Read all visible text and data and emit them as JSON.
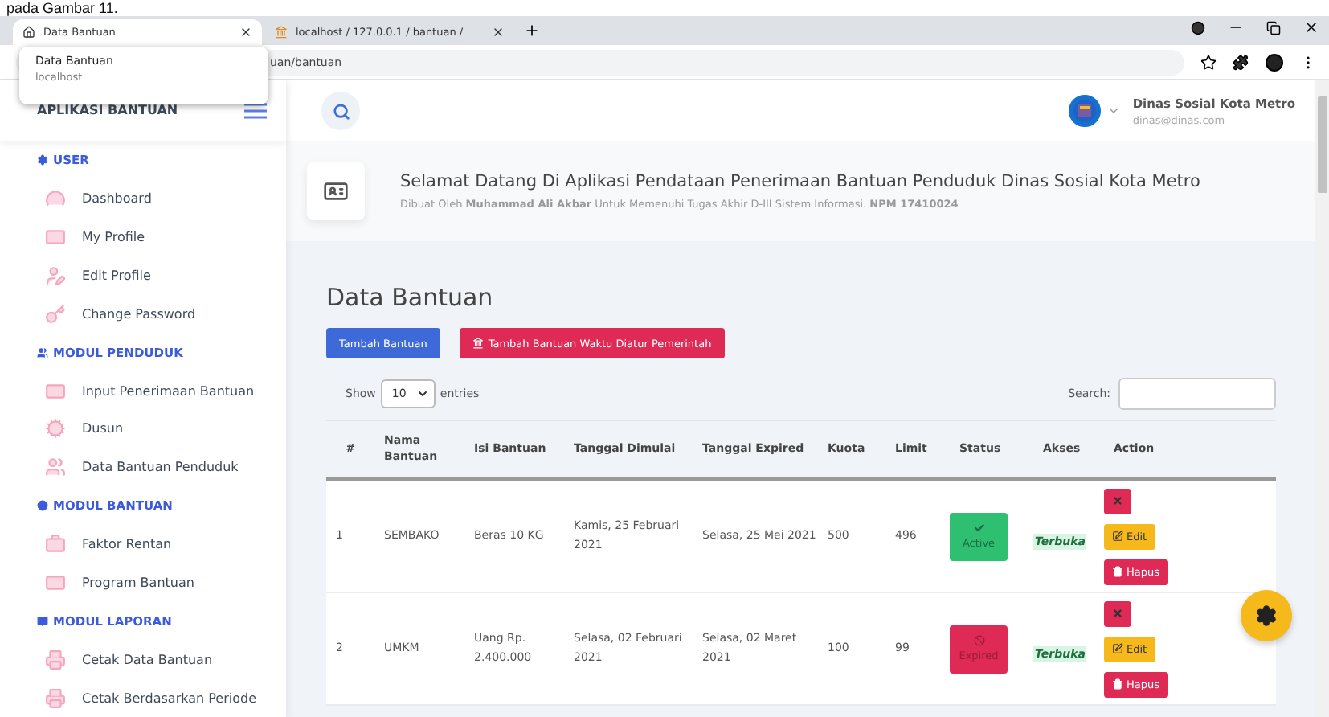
{
  "caption_fragment": "pada Gambar 11.",
  "browser": {
    "tabs": [
      {
        "title": "Data Bantuan",
        "selected": true
      },
      {
        "title": "localhost / 127.0.0.1 / bantuan /",
        "selected": false
      }
    ],
    "address": "uan/bantuan",
    "tooltip": {
      "title": "Data Bantuan",
      "host": "localhost"
    }
  },
  "app": {
    "brand": "APLIKASI BANTUAN",
    "user": {
      "name": "Dinas Sosial Kota Metro",
      "email": "dinas@dinas.com"
    }
  },
  "sidebar": {
    "sections": [
      {
        "title": "USER",
        "items": [
          "Dashboard",
          "My Profile",
          "Edit Profile",
          "Change Password"
        ]
      },
      {
        "title": "MODUL PENDUDUK",
        "items": [
          "Input Penerimaan Bantuan",
          "Dusun",
          "Data Bantuan Penduduk"
        ]
      },
      {
        "title": "MODUL BANTUAN",
        "items": [
          "Faktor Rentan",
          "Program Bantuan"
        ]
      },
      {
        "title": "MODUL LAPORAN",
        "items": [
          "Cetak Data Bantuan",
          "Cetak Berdasarkan Periode"
        ]
      }
    ]
  },
  "welcome": {
    "title": "Selamat Datang Di Aplikasi Pendataan Penerimaan Bantuan Penduduk Dinas Sosial Kota Metro",
    "subtitle": "Dibuat Oleh **Muhammad Ali Akbar** Untuk Memenuhi Tugas Akhir D-III Sistem Informasi. **NPM 17410024**"
  },
  "page": {
    "heading": "Data Bantuan",
    "buttons": [
      {
        "label": "Tambah Bantuan",
        "kind": "primary"
      },
      {
        "label": "Tambah Bantuan Waktu Diatur Pemerintah",
        "kind": "danger"
      }
    ],
    "show_label": "Show",
    "entries_value": "10",
    "entries_label": "entries",
    "search_label": "Search:"
  },
  "table": {
    "columns": [
      "#",
      "Nama Bantuan",
      "Isi Bantuan",
      "Tanggal Dimulai",
      "Tanggal Expired",
      "Kuota",
      "Limit",
      "Status",
      "Akses",
      "Action"
    ],
    "rows": [
      {
        "no": "1",
        "nama": "SEMBAKO",
        "isi": "Beras 10 KG",
        "mulai": "Kamis, 25 Februari 2021",
        "expired": "Selasa, 25 Mei 2021",
        "kuota": "500",
        "limit": "496",
        "status": {
          "kind": "active",
          "label": "Active"
        },
        "akses": "Terbuka",
        "actions": [
          "Edit",
          "Hapus"
        ]
      },
      {
        "no": "2",
        "nama": "UMKM",
        "isi": "Uang Rp. 2.400.000",
        "mulai": "Selasa, 02 Februari 2021",
        "expired": "Selasa, 02 Maret 2021",
        "kuota": "100",
        "limit": "99",
        "status": {
          "kind": "expired",
          "label": "Expired"
        },
        "akses": "Terbuka",
        "actions": [
          "Edit",
          "Hapus"
        ]
      }
    ]
  }
}
